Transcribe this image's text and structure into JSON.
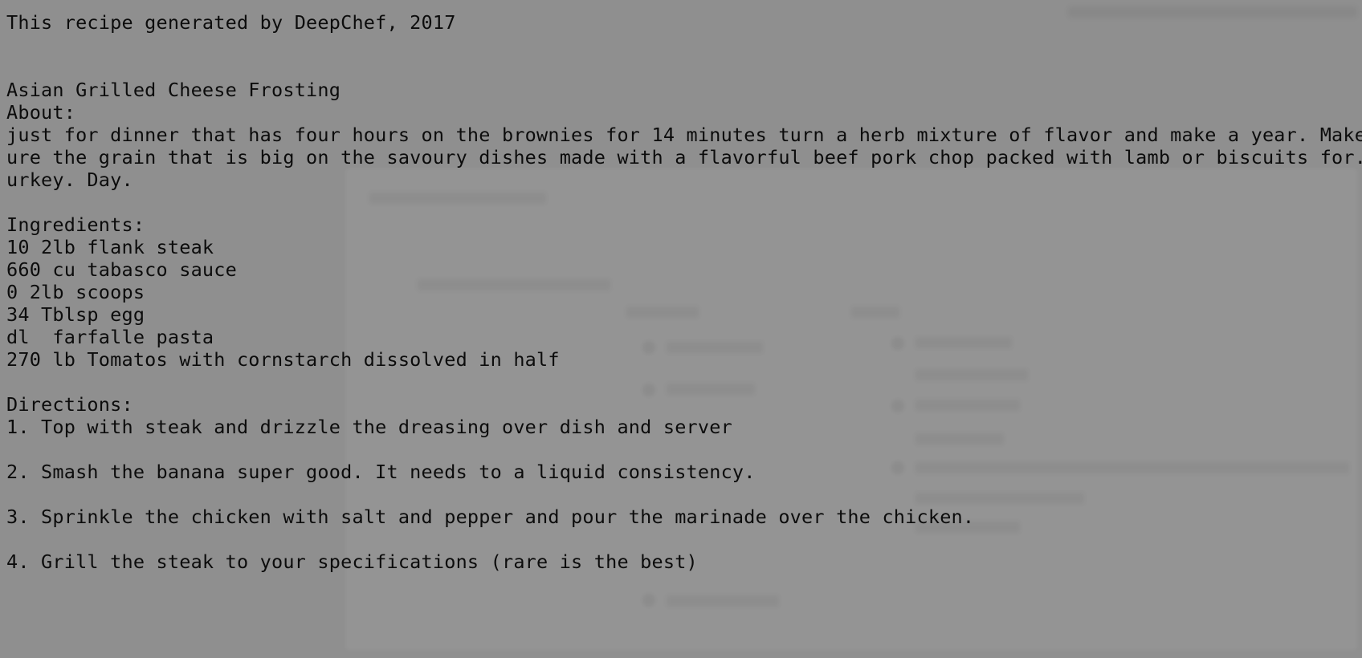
{
  "header": {
    "credit": "This recipe generated by DeepChef, 2017"
  },
  "recipe": {
    "title": "Asian Grilled Cheese Frosting",
    "about_label": "About:",
    "about_lines": [
      "just for dinner that has four hours on the brownies for 14 minutes turn a herb mixture of flavor and make a year. Make s",
      "ure the grain that is big on the savoury dishes made with a flavorful beef pork chop packed with lamb or biscuits for. T",
      "urkey. Day."
    ],
    "ingredients_label": "Ingredients:",
    "ingredients": [
      "10 2lb flank steak",
      "660 cu tabasco sauce",
      "0 2lb scoops",
      "34 Tblsp egg",
      "dl  farfalle pasta",
      "270 lb Tomatos with cornstarch dissolved in half"
    ],
    "directions_label": "Directions:",
    "directions": [
      "1. Top with steak and drizzle the dreasing over dish and server",
      "2. Smash the banana super good. It needs to a liquid consistency.",
      "3. Sprinkle the chicken with salt and pepper and pour the marinade over the chicken.",
      "4. Grill the steak to your specifications (rare is the best)"
    ]
  },
  "theme": {
    "background": "#8f8f8f",
    "text": "#0c0c0c"
  }
}
